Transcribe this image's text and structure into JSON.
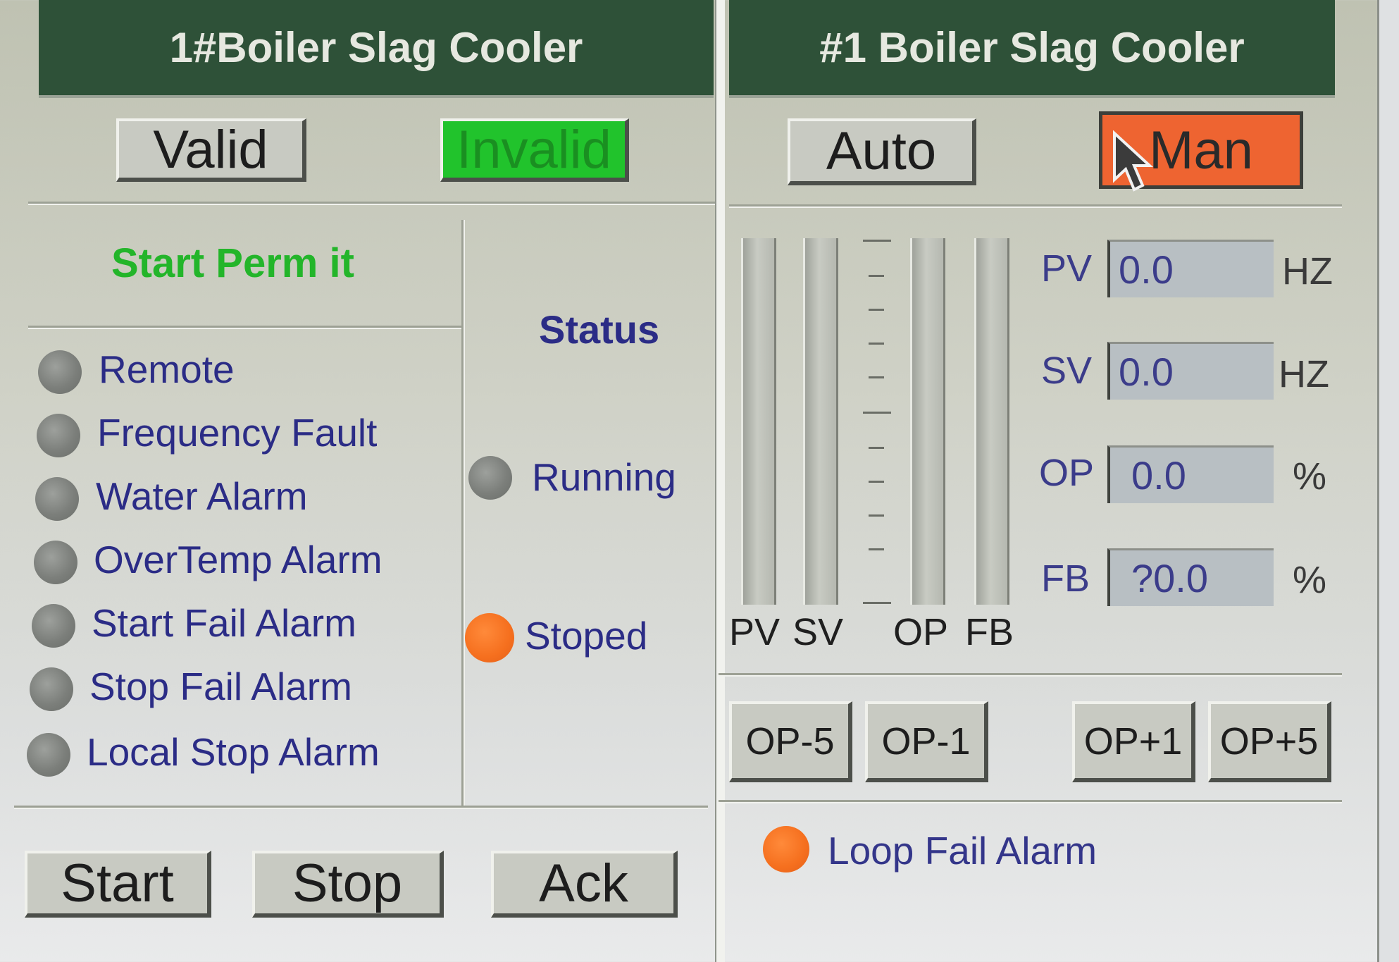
{
  "left_panel": {
    "title": "1#Boiler Slag Cooler",
    "valid_label": "Valid",
    "invalid_label": "Invalid",
    "start_permit_title": "Start  Perm it",
    "alarms": [
      "Remote",
      "Frequency Fault",
      "Water Alarm",
      "OverTemp Alarm",
      "Start Fail Alarm",
      "Stop Fail Alarm",
      "Local Stop Alarm"
    ],
    "status_title": "Status",
    "status_running": "Running",
    "status_stopped": "Stoped",
    "buttons": {
      "start": "Start",
      "stop": "Stop",
      "ack": "Ack"
    }
  },
  "right_panel": {
    "title": "#1 Boiler Slag Cooler",
    "auto_label": "Auto",
    "man_label": "Man",
    "bar_labels": {
      "pv": "PV",
      "sv": "SV",
      "op": "OP",
      "fb": "FB"
    },
    "values": {
      "pv": {
        "label": "PV",
        "value": "0.0",
        "unit": "HZ"
      },
      "sv": {
        "label": "SV",
        "value": "0.0",
        "unit": "HZ"
      },
      "op": {
        "label": "OP",
        "value": "0.0",
        "unit": "%"
      },
      "fb": {
        "label": "FB",
        "value": "?0.0",
        "unit": "%"
      }
    },
    "op_buttons": {
      "minus5": "OP-5",
      "minus1": "OP-1",
      "plus1": "OP+1",
      "plus5": "OP+5"
    },
    "loop_fail_label": "Loop Fail Alarm"
  },
  "colors": {
    "header_bg": "#2e5138",
    "invalid_active": "#21c32c",
    "man_active": "#ee6431",
    "led_on": "#f56f1e",
    "led_off": "#7c7f7b",
    "label_text": "#2b2c86"
  }
}
